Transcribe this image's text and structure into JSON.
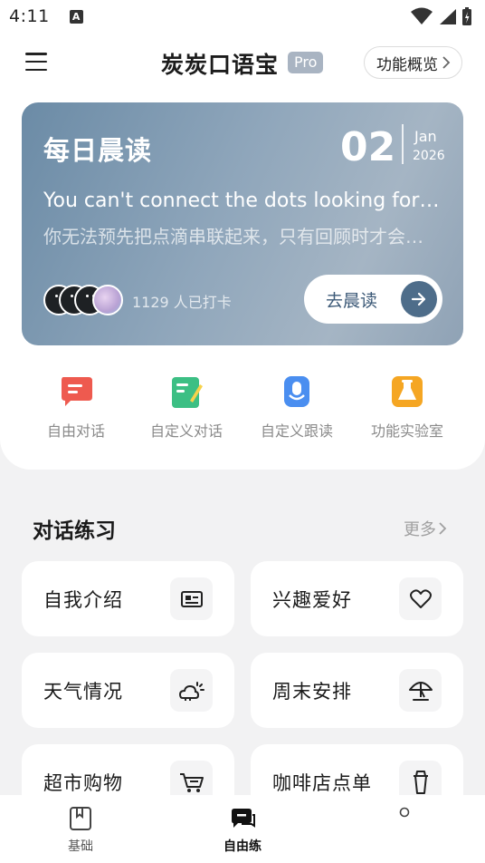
{
  "status_bar": {
    "time": "4:11",
    "notification_icon": "a-box-icon",
    "icons": [
      "wifi-icon",
      "signal-icon",
      "battery-icon"
    ]
  },
  "header": {
    "title": "炭炭口语宝",
    "badge": "Pro",
    "overview_button": "功能概览"
  },
  "daily_reading": {
    "title": "每日晨读",
    "day": "02",
    "month": "Jan",
    "year": "2026",
    "quote_en": "You can't connect the dots looking forw…",
    "quote_zh": "你无法预先把点滴串联起来，只有回顾时才会…",
    "checkin_text": "1129 人已打卡",
    "go_button": "去晨读"
  },
  "shortcuts": [
    {
      "label": "自由对话",
      "icon": "chat-bubble-icon",
      "color": "#ee5a4f"
    },
    {
      "label": "自定义对话",
      "icon": "edit-note-icon",
      "color": "#3cbf84"
    },
    {
      "label": "自定义跟读",
      "icon": "microphone-icon",
      "color": "#4a8ef0"
    },
    {
      "label": "功能实验室",
      "icon": "flask-icon",
      "color": "#f5a623"
    }
  ],
  "practice": {
    "title": "对话练习",
    "more": "更多",
    "topics": [
      {
        "label": "自我介绍",
        "icon": "id-card-icon"
      },
      {
        "label": "兴趣爱好",
        "icon": "heart-icon"
      },
      {
        "label": "天气情况",
        "icon": "weather-icon"
      },
      {
        "label": "周末安排",
        "icon": "beach-umbrella-icon"
      },
      {
        "label": "超市购物",
        "icon": "shopping-cart-icon"
      },
      {
        "label": "咖啡店点单",
        "icon": "coffee-cup-icon"
      }
    ]
  },
  "bottom_nav": [
    {
      "label": "基础",
      "icon": "bookmark-book-icon"
    },
    {
      "label": "自由练",
      "icon": "chat-icon",
      "active": true
    },
    {
      "label": "",
      "icon": "profile-icon"
    }
  ]
}
